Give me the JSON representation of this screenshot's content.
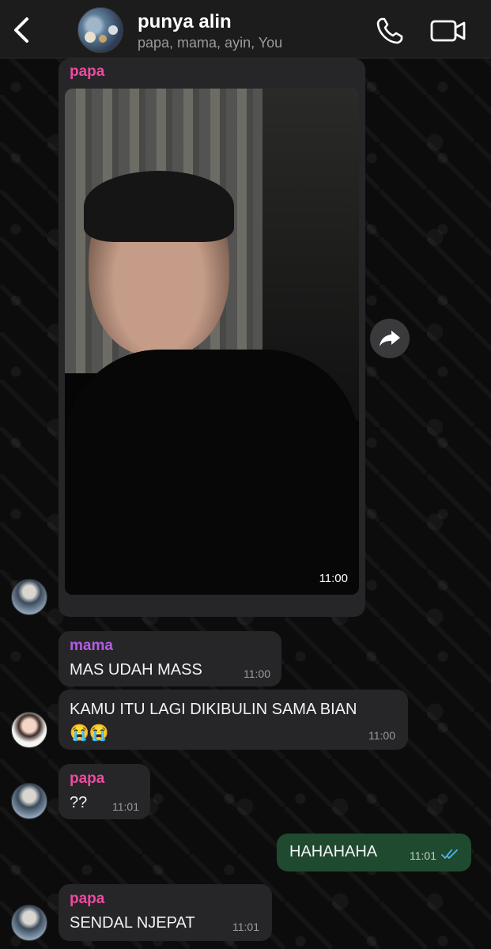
{
  "header": {
    "title": "punya alin",
    "subtitle": "papa, mama, ayin, You"
  },
  "messages": [
    {
      "sender": "papa",
      "type": "photo",
      "time": "11:00"
    },
    {
      "sender": "mama",
      "text": "MAS UDAH MASS",
      "time": "11:00"
    },
    {
      "text": "KAMU ITU LAGI DIKIBULIN SAMA BIAN",
      "emoji": "😭😭",
      "time": "11:00"
    },
    {
      "sender": "papa",
      "text": "??",
      "time": "11:01"
    },
    {
      "text": "HAHAHAHA",
      "time": "11:01",
      "status": "read"
    },
    {
      "sender": "papa",
      "text": "SENDAL NJEPAT",
      "time": "11:01"
    }
  ],
  "colors": {
    "papa_name": "#ee4aa1",
    "mama_name": "#b45be6",
    "incoming_bubble": "#262628",
    "outgoing_bubble": "#1f4a2f",
    "read_ticks": "#4fb6ec"
  }
}
